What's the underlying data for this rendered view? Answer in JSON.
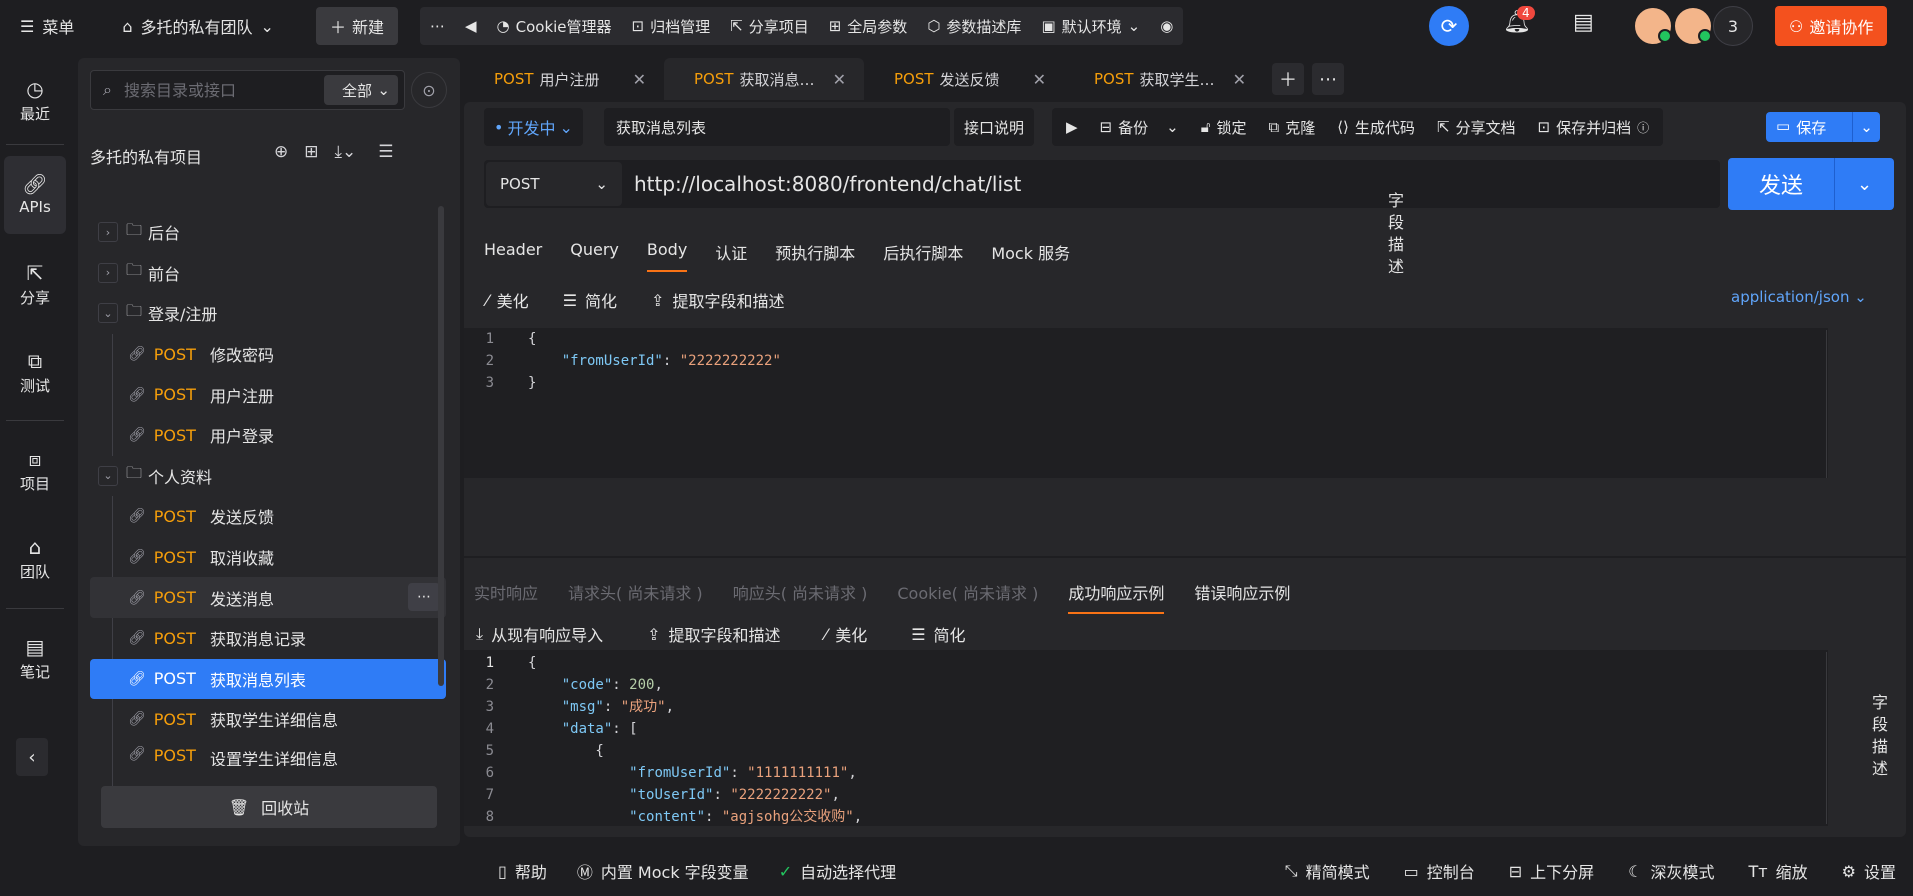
{
  "topbar": {
    "menu_label": "菜单",
    "team_name": "多托的私有团队",
    "new_label": "新建",
    "tools": [
      "Cookie管理器",
      "归档管理",
      "分享项目",
      "全局参数",
      "参数描述库",
      "默认环境"
    ],
    "notifications": "4",
    "member_count": "3",
    "invite_label": "邀请协作"
  },
  "leftnav": {
    "items": [
      "最近",
      "APIs",
      "分享",
      "测试",
      "项目",
      "团队",
      "笔记"
    ]
  },
  "sidebar": {
    "search_placeholder": "搜索目录或接口",
    "scope": "全部",
    "project_title": "多托的私有项目",
    "folders": {
      "backend": "后台",
      "frontend": "前台",
      "auth": "登录/注册",
      "profile": "个人资料"
    },
    "method": "POST",
    "auth_items": [
      "修改密码",
      "用户注册",
      "用户登录"
    ],
    "profile_items": [
      "发送反馈",
      "取消收藏",
      "发送消息",
      "获取消息记录",
      "获取消息列表",
      "获取学生详细信息",
      "设置学生详细信息"
    ],
    "recycle_label": "回收站"
  },
  "tabs": [
    {
      "method": "POST",
      "name": "用户注册"
    },
    {
      "method": "POST",
      "name": "获取消息…"
    },
    {
      "method": "POST",
      "name": "发送反馈"
    },
    {
      "method": "POST",
      "name": "获取学生…"
    }
  ],
  "api": {
    "status": "开发中",
    "name": "获取消息列表",
    "desc_label": "接口说明",
    "actions": [
      "备份",
      "锁定",
      "克隆",
      "生成代码",
      "分享文档",
      "保存并归档"
    ],
    "save_label": "保存",
    "method": "POST",
    "url": "http://localhost:8080/frontend/chat/list",
    "send_label": "发送"
  },
  "request": {
    "tabs": [
      "Header",
      "Query",
      "Body",
      "认证",
      "预执行脚本",
      "后执行脚本",
      "Mock 服务"
    ],
    "tools": [
      "美化",
      "简化",
      "提取字段和描述"
    ],
    "content_type": "application/json",
    "field_desc": "字段描述",
    "body": {
      "key": "\"fromUserId\"",
      "value": "\"2222222222\""
    }
  },
  "response": {
    "tabs": [
      "实时响应",
      "请求头( 尚未请求 )",
      "响应头( 尚未请求 )",
      "Cookie( 尚未请求 )",
      "成功响应示例",
      "错误响应示例"
    ],
    "tools": [
      "从现有响应导入",
      "提取字段和描述",
      "美化",
      "简化"
    ],
    "field_desc": "字段描述",
    "json": {
      "code_key": "\"code\"",
      "code_val": "200",
      "msg_key": "\"msg\"",
      "msg_val": "\"成功\"",
      "data_key": "\"data\"",
      "from_key": "\"fromUserId\"",
      "from_val": "\"1111111111\"",
      "to_key": "\"toUserId\"",
      "to_val": "\"2222222222\"",
      "content_key": "\"content\"",
      "content_val": "\"agjsohg公交收购\""
    }
  },
  "footer": {
    "left": [
      "帮助",
      "内置 Mock 字段变量",
      "自动选择代理"
    ],
    "right": [
      "精简模式",
      "控制台",
      "上下分屏",
      "深灰模式",
      "缩放",
      "设置"
    ]
  }
}
